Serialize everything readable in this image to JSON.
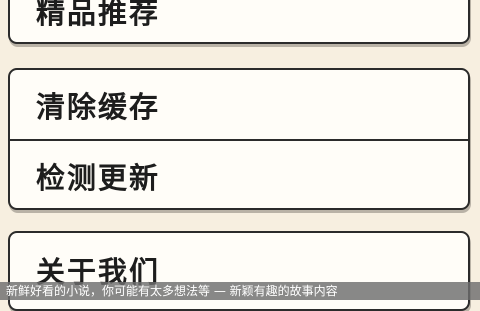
{
  "menu": {
    "featured": "精品推荐",
    "clear_cache": "清除缓存",
    "check_update": "检测更新",
    "about_us": "关于我们"
  },
  "toast": {
    "text": "新鲜好看的小说，你可能有太多想法等 — 新颖有趣的故事内容"
  }
}
